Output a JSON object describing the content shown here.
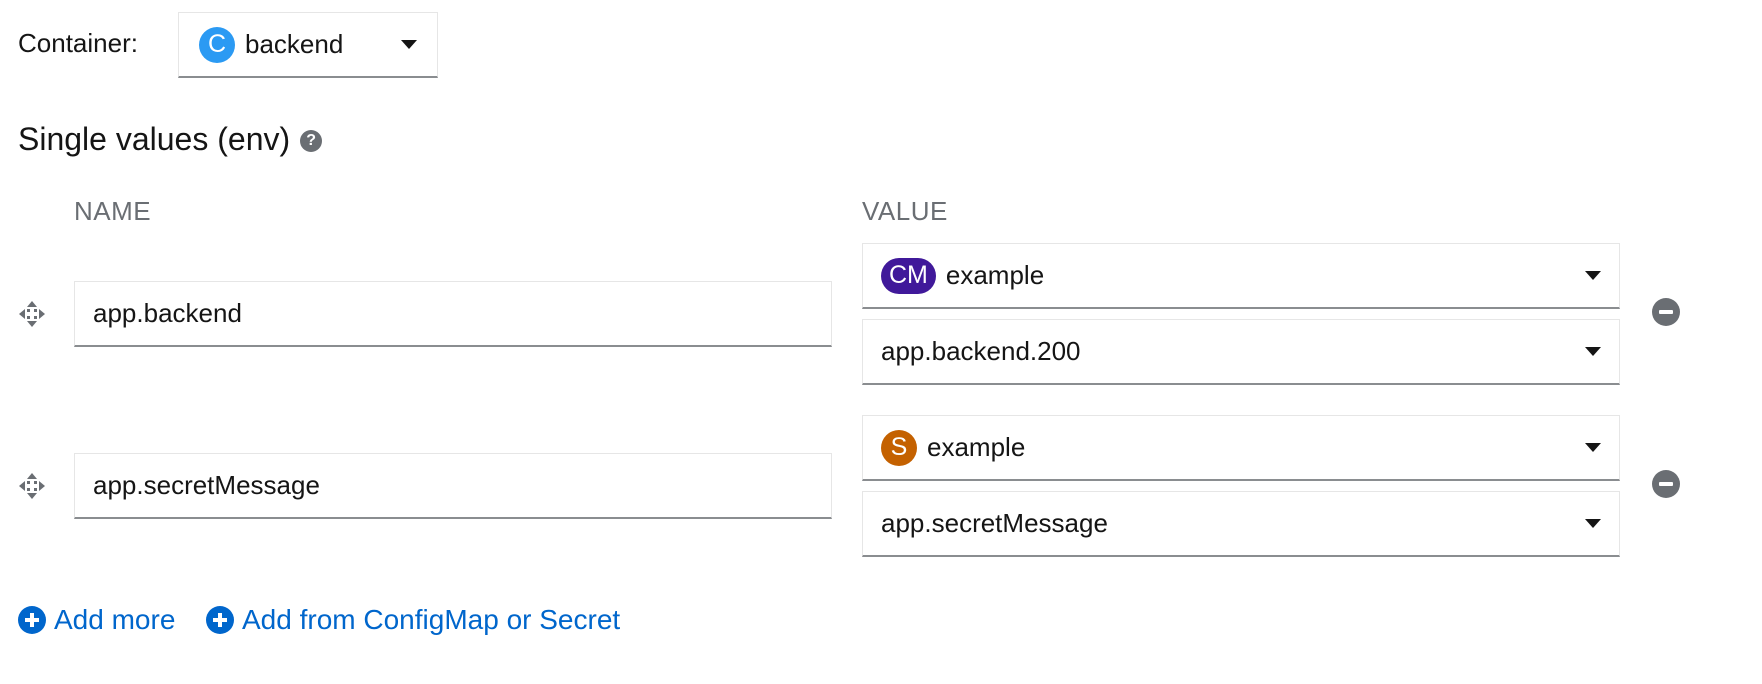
{
  "container": {
    "label": "Container:",
    "badge": "C",
    "selected": "backend"
  },
  "section": {
    "title": "Single values (env)"
  },
  "columns": {
    "name": "NAME",
    "value": "VALUE"
  },
  "rows": [
    {
      "name": "app.backend",
      "resource_badge": "CM",
      "resource_name": "example",
      "key": "app.backend.200"
    },
    {
      "name": "app.secretMessage",
      "resource_badge": "S",
      "resource_name": "example",
      "key": "app.secretMessage"
    }
  ],
  "actions": {
    "add_more": "Add more",
    "add_from": "Add from ConfigMap or Secret"
  },
  "colors": {
    "link": "#0066cc",
    "badge_container": "#2b9af3",
    "badge_configmap": "#40199a",
    "badge_secret": "#c46100"
  },
  "icons": [
    "drag-handle-icon",
    "help-icon",
    "caret-down-icon",
    "remove-icon",
    "plus-circle-icon"
  ]
}
